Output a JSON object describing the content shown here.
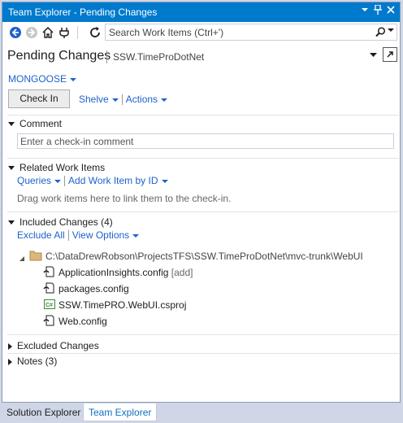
{
  "window": {
    "title": "Team Explorer - Pending Changes"
  },
  "search": {
    "placeholder": "Search Work Items (Ctrl+')"
  },
  "header": {
    "title": "Pending Changes",
    "project": "SSW.TimeProDotNet"
  },
  "workspace": {
    "label": "MONGOOSE"
  },
  "buttons": {
    "check_in": "Check In",
    "shelve": "Shelve",
    "actions": "Actions"
  },
  "comment": {
    "heading": "Comment",
    "placeholder": "Enter a check-in comment"
  },
  "related": {
    "heading": "Related Work Items",
    "queries": "Queries",
    "add_by_id": "Add Work Item by ID",
    "hint": "Drag work items here to link them to the check-in."
  },
  "included": {
    "heading": "Included Changes (4)",
    "exclude_all": "Exclude All",
    "view_options": "View Options",
    "folder": "C:\\DataDrewRobson\\ProjectsTFS\\SSW.TimeProDotNet\\mvc-trunk\\WebUI",
    "files": [
      {
        "name": "ApplicationInsights.config",
        "tag": "[add]",
        "icon": "config-file-icon"
      },
      {
        "name": "packages.config",
        "tag": "",
        "icon": "config-file-icon"
      },
      {
        "name": "SSW.TimePRO.WebUI.csproj",
        "tag": "",
        "icon": "csharp-project-icon"
      },
      {
        "name": "Web.config",
        "tag": "",
        "icon": "config-file-icon"
      }
    ]
  },
  "excluded": {
    "heading": "Excluded Changes"
  },
  "notes": {
    "heading": "Notes (3)"
  },
  "bottom_tabs": [
    {
      "label": "Solution Explorer",
      "active": false
    },
    {
      "label": "Team Explorer",
      "active": true
    }
  ],
  "colors": {
    "accent": "#007ACC",
    "link": "#1E61CC"
  }
}
